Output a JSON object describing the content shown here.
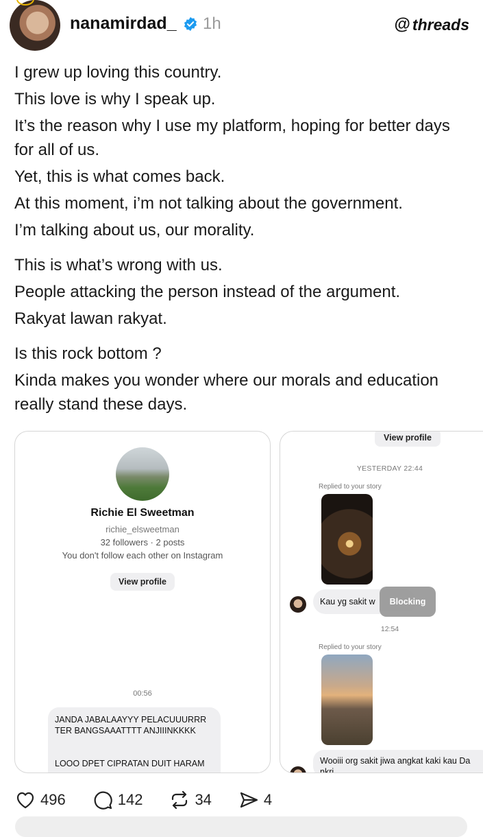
{
  "post": {
    "username": "nanamirdad_",
    "time_ago": "1h",
    "brand": "threads",
    "paragraphs": [
      [
        "I grew up loving this country.",
        "This love is why I speak up.",
        "It’s the reason why I use my platform, hoping for better days for all of us.",
        "Yet, this is what comes back.",
        "At this moment, i’m not talking about the government.",
        "I’m talking about us, our morality."
      ],
      [
        "This is what’s wrong with us.",
        "People attacking the person instead of the argument.",
        "Rakyat lawan rakyat."
      ],
      [
        "Is this rock bottom ?",
        "Kinda makes you wonder where our morals and education really stand these days."
      ]
    ]
  },
  "screenshot_left": {
    "profile_name": "Richie El Sweetman",
    "profile_handle": "richie_elsweetman",
    "profile_stats": "32 followers · 2 posts",
    "profile_note": "You don't follow each other on Instagram",
    "view_profile": "View profile",
    "time": "00:56",
    "message_line1": "JANDA JABALAAYYY PELACUUURRR TER BANGSAAATTTT ANJIIINKKKK",
    "message_line2": "LOOO DPET CIPRATAN DUIT HARAM"
  },
  "screenshot_right": {
    "view_profile": "View profile",
    "yesterday": "YESTERDAY 22:44",
    "replied_1": "Replied to your story",
    "reply_1": "Kau yg sakit w",
    "blocking": "Blocking",
    "time_2": "12:54",
    "replied_2": "Replied to your story",
    "reply_2": "Wooiii org sakit jiwa angkat kaki kau Da nkri"
  },
  "actions": {
    "likes": "496",
    "comments": "142",
    "reposts": "34",
    "shares": "4"
  },
  "colors": {
    "verified": "#1d9bf0",
    "text": "#1a1a1a",
    "muted": "#9a9a9a"
  }
}
